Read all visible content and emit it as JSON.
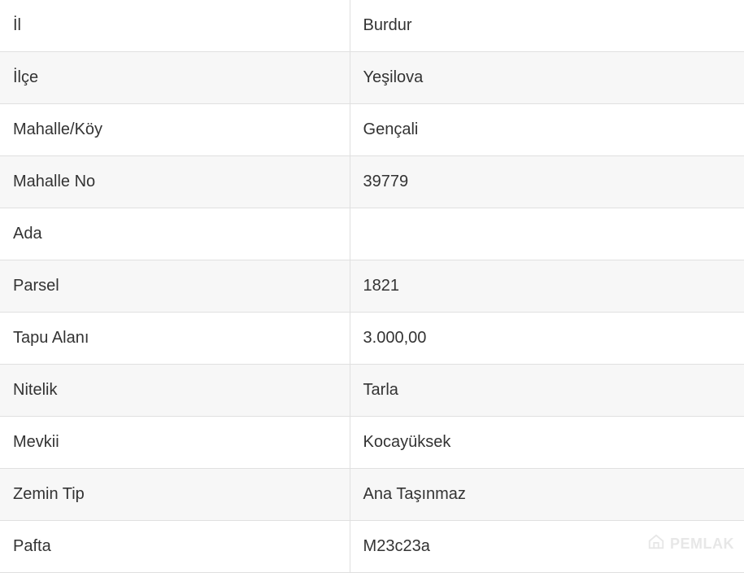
{
  "rows": [
    {
      "label": "İl",
      "value": "Burdur"
    },
    {
      "label": "İlçe",
      "value": "Yeşilova"
    },
    {
      "label": "Mahalle/Köy",
      "value": "Gençali"
    },
    {
      "label": "Mahalle No",
      "value": "39779"
    },
    {
      "label": "Ada",
      "value": ""
    },
    {
      "label": "Parsel",
      "value": "1821"
    },
    {
      "label": "Tapu Alanı",
      "value": "3.000,00"
    },
    {
      "label": "Nitelik",
      "value": "Tarla"
    },
    {
      "label": "Mevkii",
      "value": "Kocayüksek"
    },
    {
      "label": "Zemin Tip",
      "value": "Ana Taşınmaz"
    },
    {
      "label": "Pafta",
      "value": "M23c23a"
    }
  ],
  "watermark": {
    "text": "PEMLAK"
  }
}
